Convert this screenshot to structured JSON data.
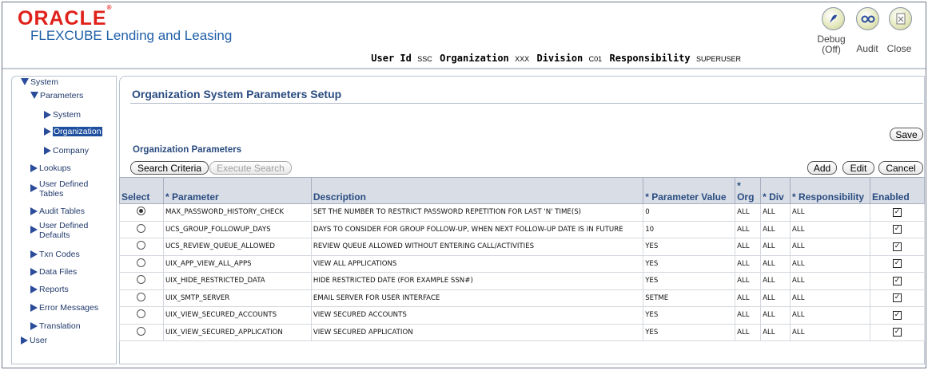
{
  "header": {
    "brand": "ORACLE",
    "product": "FLEXCUBE Lending and Leasing",
    "user_id_label": "User Id",
    "user_id_value": "SSC",
    "org_label": "Organization",
    "org_value": "XXX",
    "division_label": "Division",
    "division_value": "C01",
    "responsibility_label": "Responsibility",
    "responsibility_value": "SUPERUSER",
    "debug_label": "Debug",
    "debug_state": "(Off)",
    "audit_label": "Audit",
    "close_label": "Close"
  },
  "sidebar": {
    "items": [
      {
        "label": "System"
      },
      {
        "label": "Parameters"
      },
      {
        "label": "System"
      },
      {
        "label": "Organization"
      },
      {
        "label": "Company"
      },
      {
        "label": "Lookups"
      },
      {
        "label": "User Defined Tables"
      },
      {
        "label": "Audit Tables"
      },
      {
        "label": "User Defined Defaults"
      },
      {
        "label": "Txn Codes"
      },
      {
        "label": "Data Files"
      },
      {
        "label": "Reports"
      },
      {
        "label": "Error Messages"
      },
      {
        "label": "Translation"
      },
      {
        "label": "User"
      }
    ]
  },
  "main": {
    "title": "Organization System Parameters Setup",
    "save_label": "Save",
    "section_title": "Organization Parameters",
    "search_criteria_label": "Search Criteria",
    "execute_search_label": "Execute Search",
    "add_label": "Add",
    "edit_label": "Edit",
    "cancel_label": "Cancel"
  },
  "table": {
    "columns": [
      "Select",
      "Parameter",
      "Description",
      "Parameter Value",
      "Org",
      "Div",
      "Responsibility",
      "Enabled"
    ],
    "required_mark": "*",
    "rows": [
      {
        "selected": true,
        "parameter": "MAX_PASSWORD_HISTORY_CHECK",
        "description": "SET THE NUMBER TO RESTRICT PASSWORD REPETITION FOR LAST 'N' TIME(S)",
        "value": "0",
        "org": "ALL",
        "div": "ALL",
        "resp": "ALL",
        "enabled": true
      },
      {
        "selected": false,
        "parameter": "UCS_GROUP_FOLLOWUP_DAYS",
        "description": "DAYS TO CONSIDER FOR GROUP FOLLOW-UP, WHEN NEXT FOLLOW-UP DATE IS IN FUTURE",
        "value": "10",
        "org": "ALL",
        "div": "ALL",
        "resp": "ALL",
        "enabled": true
      },
      {
        "selected": false,
        "parameter": "UCS_REVIEW_QUEUE_ALLOWED",
        "description": "REVIEW QUEUE ALLOWED WITHOUT ENTERING CALL/ACTIVITIES",
        "value": "YES",
        "org": "ALL",
        "div": "ALL",
        "resp": "ALL",
        "enabled": true
      },
      {
        "selected": false,
        "parameter": "UIX_APP_VIEW_ALL_APPS",
        "description": "VIEW ALL APPLICATIONS",
        "value": "YES",
        "org": "ALL",
        "div": "ALL",
        "resp": "ALL",
        "enabled": true
      },
      {
        "selected": false,
        "parameter": "UIX_HIDE_RESTRICTED_DATA",
        "description": "HIDE RESTRICTED DATE (FOR EXAMPLE SSN#)",
        "value": "YES",
        "org": "ALL",
        "div": "ALL",
        "resp": "ALL",
        "enabled": true
      },
      {
        "selected": false,
        "parameter": "UIX_SMTP_SERVER",
        "description": "EMAIL SERVER FOR USER INTERFACE",
        "value": "SETME",
        "org": "ALL",
        "div": "ALL",
        "resp": "ALL",
        "enabled": true
      },
      {
        "selected": false,
        "parameter": "UIX_VIEW_SECURED_ACCOUNTS",
        "description": "VIEW SECURED ACCOUNTS",
        "value": "YES",
        "org": "ALL",
        "div": "ALL",
        "resp": "ALL",
        "enabled": true
      },
      {
        "selected": false,
        "parameter": "UIX_VIEW_SECURED_APPLICATION",
        "description": "VIEW SECURED APPLICATION",
        "value": "YES",
        "org": "ALL",
        "div": "ALL",
        "resp": "ALL",
        "enabled": true
      }
    ]
  },
  "colors": {
    "brand_red": "#e0201b",
    "product_blue": "#1f5fa8",
    "header_text": "#2a4c80",
    "nav_selected": "#1e4f9e",
    "table_header_bg": "#d8dde6"
  }
}
